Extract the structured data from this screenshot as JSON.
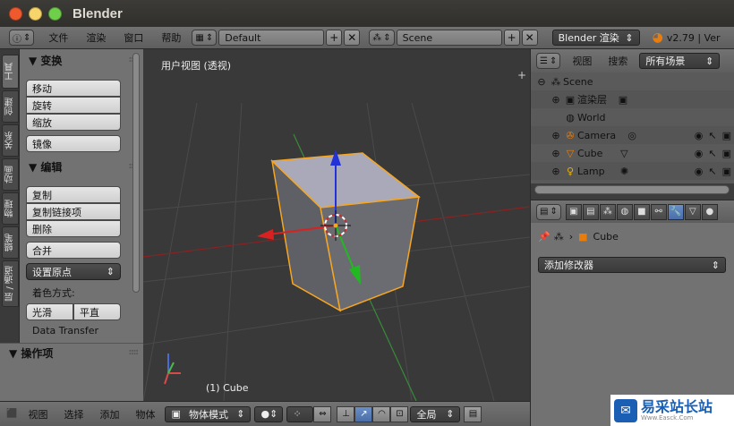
{
  "window": {
    "title": "Blender"
  },
  "info_header": {
    "menus": [
      "文件",
      "渲染",
      "窗口",
      "帮助"
    ],
    "screen_layout": "Default",
    "scene": "Scene",
    "render_engine": "Blender 渲染",
    "version": "v2.79 | Ver"
  },
  "tool_tabs": [
    "工具",
    "创建",
    "关系",
    "动画",
    "物理",
    "蜡笔",
    "层 / 通道"
  ],
  "tool_shelf": {
    "transform": {
      "title": "▼ 变换",
      "buttons": [
        "移动",
        "旋转",
        "缩放"
      ],
      "mirror": "镜像"
    },
    "edit": {
      "title": "▼ 编辑",
      "buttons": [
        "复制",
        "复制链接项",
        "删除"
      ],
      "join": "合并",
      "set_origin": "设置原点",
      "shading_label": "着色方式:",
      "smooth": "光滑",
      "flat": "平直",
      "cut_text": "Data Transfer"
    },
    "operator": {
      "title": "▼ 操作项"
    }
  },
  "viewport": {
    "view_label": "用户视图 (透视)",
    "object_label": "(1) Cube"
  },
  "view3d_header": {
    "menus": [
      "视图",
      "选择",
      "添加",
      "物体"
    ],
    "mode": "物体模式",
    "pivot": "全局"
  },
  "outliner": {
    "menus": [
      "视图",
      "搜索"
    ],
    "filter": "所有场景",
    "rows": [
      {
        "name": "Scene",
        "icon": "scene-icon"
      },
      {
        "name": "渲染层",
        "icon": "render-layers-icon"
      },
      {
        "name": "World",
        "icon": "world-icon"
      },
      {
        "name": "Camera",
        "icon": "camera-icon"
      },
      {
        "name": "Cube",
        "icon": "mesh-icon"
      },
      {
        "name": "Lamp",
        "icon": "lamp-icon"
      }
    ]
  },
  "properties": {
    "breadcrumb_object": "Cube",
    "add_modifier": "添加修改器"
  },
  "watermark": {
    "text": "易采站长站",
    "sub": "Www.Easck.Com"
  },
  "colors": {
    "accent": "#5680c2",
    "selection": "#f5a623"
  }
}
